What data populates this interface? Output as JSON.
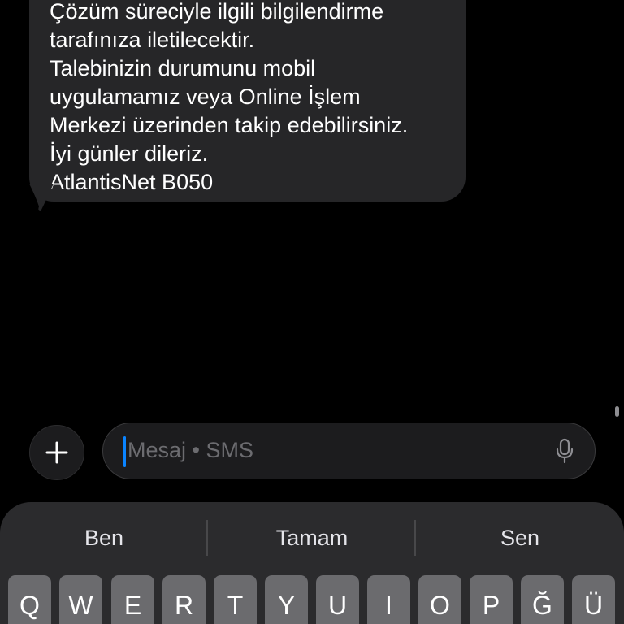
{
  "message": {
    "lines": [
      "Çözüm süreciyle ilgili bilgilendirme",
      "tarafınıza iletilecektir.",
      "Talebinizin durumunu mobil",
      "uygulamamız veya Online İşlem",
      "Merkezi üzerinden takip edebilirsiniz.",
      "İyi günler dileriz.",
      "AtlantisNet B050"
    ]
  },
  "composer": {
    "placeholder": "Mesaj • SMS",
    "plus_icon": "plus-icon",
    "mic_icon": "microphone-icon"
  },
  "keyboard": {
    "suggestions": [
      "Ben",
      "Tamam",
      "Sen"
    ],
    "row1": [
      "Q",
      "W",
      "E",
      "R",
      "T",
      "Y",
      "U",
      "I",
      "O",
      "P",
      "Ğ",
      "Ü"
    ]
  },
  "colors": {
    "background": "#000000",
    "bubble": "#262628",
    "caret": "#0a84ff",
    "key": "#6b6b6e",
    "keyboard": "#2b2b2d"
  }
}
